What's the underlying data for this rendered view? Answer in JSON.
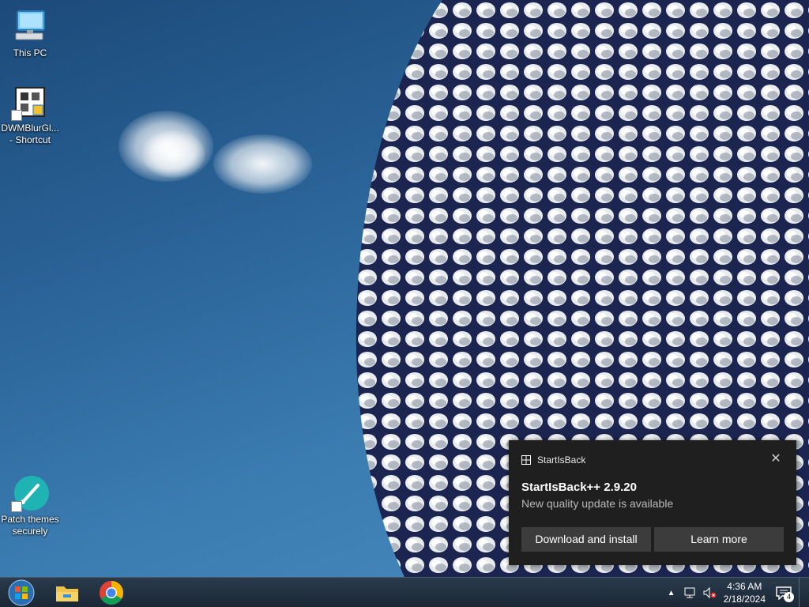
{
  "desktop": {
    "icons": [
      {
        "label": "This PC",
        "icon": "computer-icon"
      },
      {
        "label": "DWMBlurGl...\n- Shortcut",
        "icon": "app-shortcut-icon"
      },
      {
        "label": "Patch themes\nsecurely",
        "icon": "brush-icon"
      }
    ]
  },
  "notification": {
    "app_name": "StartIsBack",
    "title": "StartIsBack++ 2.9.20",
    "message": "New quality update is available",
    "primary_button": "Download and install",
    "secondary_button": "Learn more",
    "background_color": "#1f1f1f"
  },
  "taskbar": {
    "start_icon": "windows-start-orb-icon",
    "pinned": [
      {
        "name": "File Explorer",
        "icon": "folder-icon"
      },
      {
        "name": "Google Chrome",
        "icon": "chrome-icon"
      }
    ],
    "tray": {
      "time": "4:36 AM",
      "date": "2/18/2024",
      "notification_count": "4",
      "icons": [
        "chevron-up-icon",
        "network-icon",
        "volume-muted-icon",
        "action-center-icon"
      ]
    }
  }
}
